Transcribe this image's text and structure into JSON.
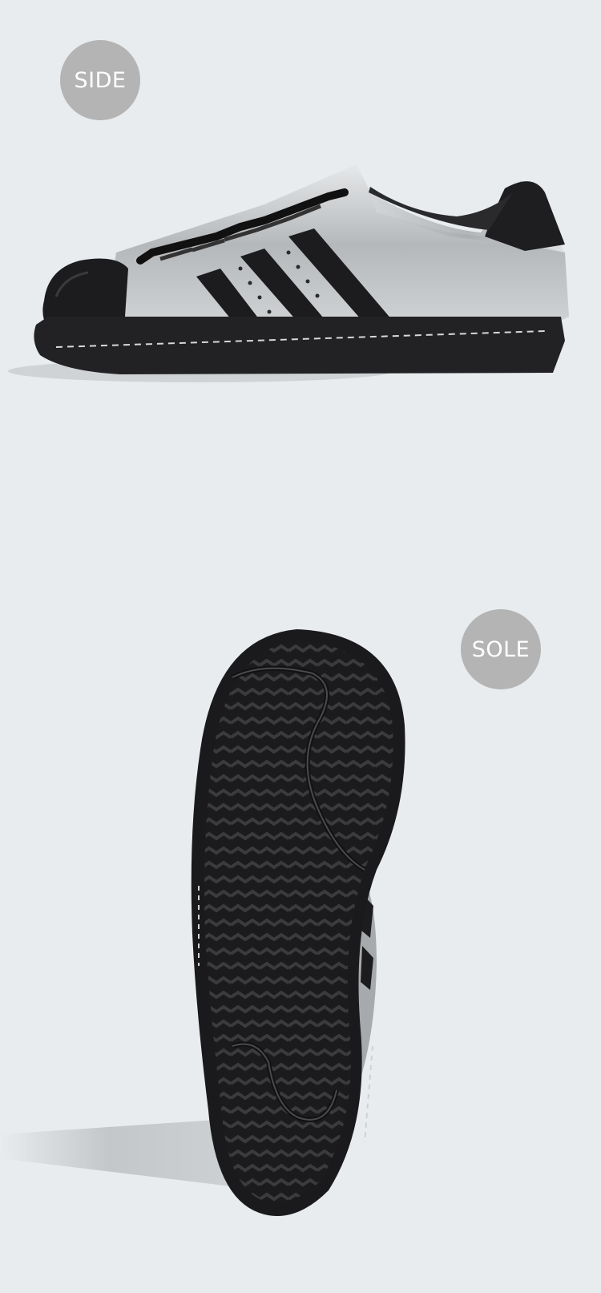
{
  "views": {
    "side": {
      "label": "SIDE"
    },
    "sole": {
      "label": "SOLE"
    }
  },
  "colors": {
    "background": "#e8ecee",
    "badge": "#b4b4b4",
    "badge_text": "#ffffff",
    "upper_silver": "#b9bcbe",
    "stripes_black": "#1c1c1e",
    "sole_black": "#222224"
  },
  "icons": [
    "sneaker-side-image",
    "sneaker-sole-image"
  ]
}
